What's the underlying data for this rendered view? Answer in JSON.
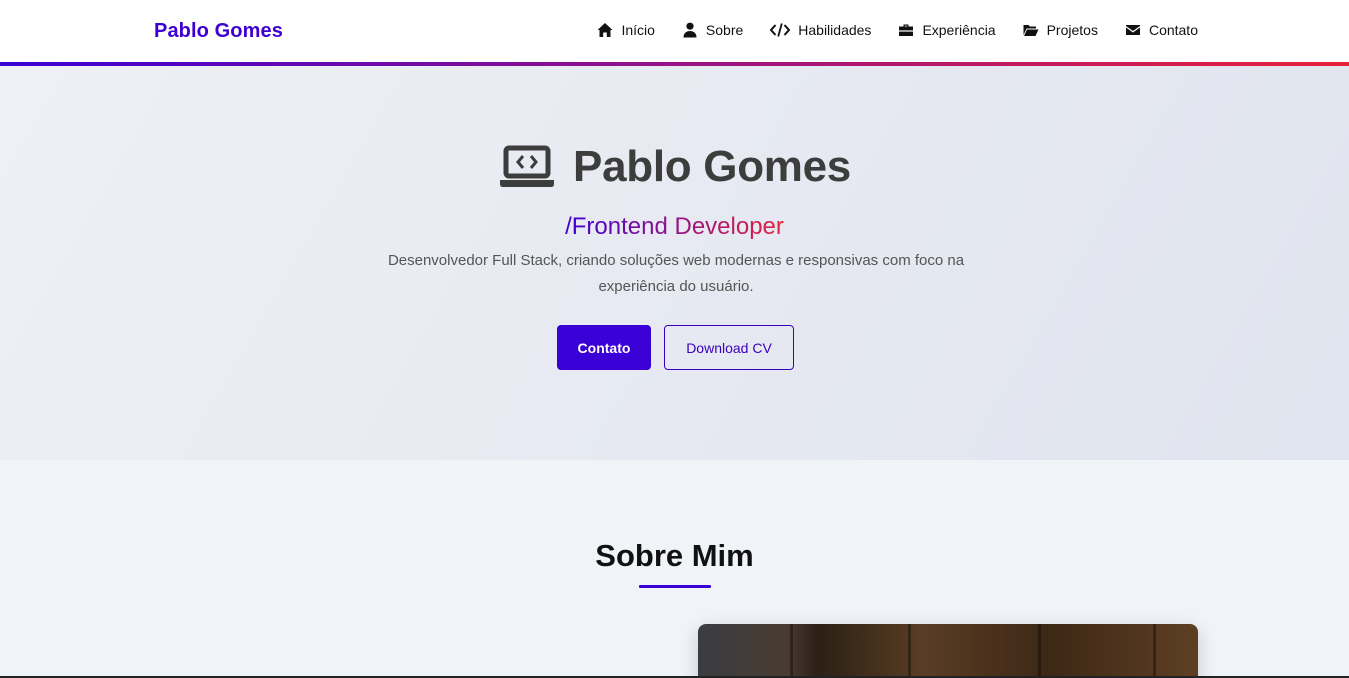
{
  "navbar": {
    "brand": "Pablo Gomes",
    "links": [
      {
        "label": "Início",
        "icon": "home-icon"
      },
      {
        "label": "Sobre",
        "icon": "user-icon"
      },
      {
        "label": "Habilidades",
        "icon": "code-icon"
      },
      {
        "label": "Experiência",
        "icon": "briefcase-icon"
      },
      {
        "label": "Projetos",
        "icon": "folder-icon"
      },
      {
        "label": "Contato",
        "icon": "envelope-icon"
      }
    ],
    "gradient": [
      "#3a00d6",
      "#a0147e",
      "#e8213a"
    ]
  },
  "hero": {
    "icon": "laptop-code-icon",
    "name": "Pablo Gomes",
    "role": "/Frontend Developer",
    "description": "Desenvolvedor Full Stack, criando soluções web modernas e responsivas com foco na experiência do usuário.",
    "primary_button": "Contato",
    "secondary_button": "Download CV"
  },
  "about": {
    "title": "Sobre Mim"
  },
  "colors": {
    "accent": "#3a00d6",
    "gradient_end": "#e8213a"
  }
}
